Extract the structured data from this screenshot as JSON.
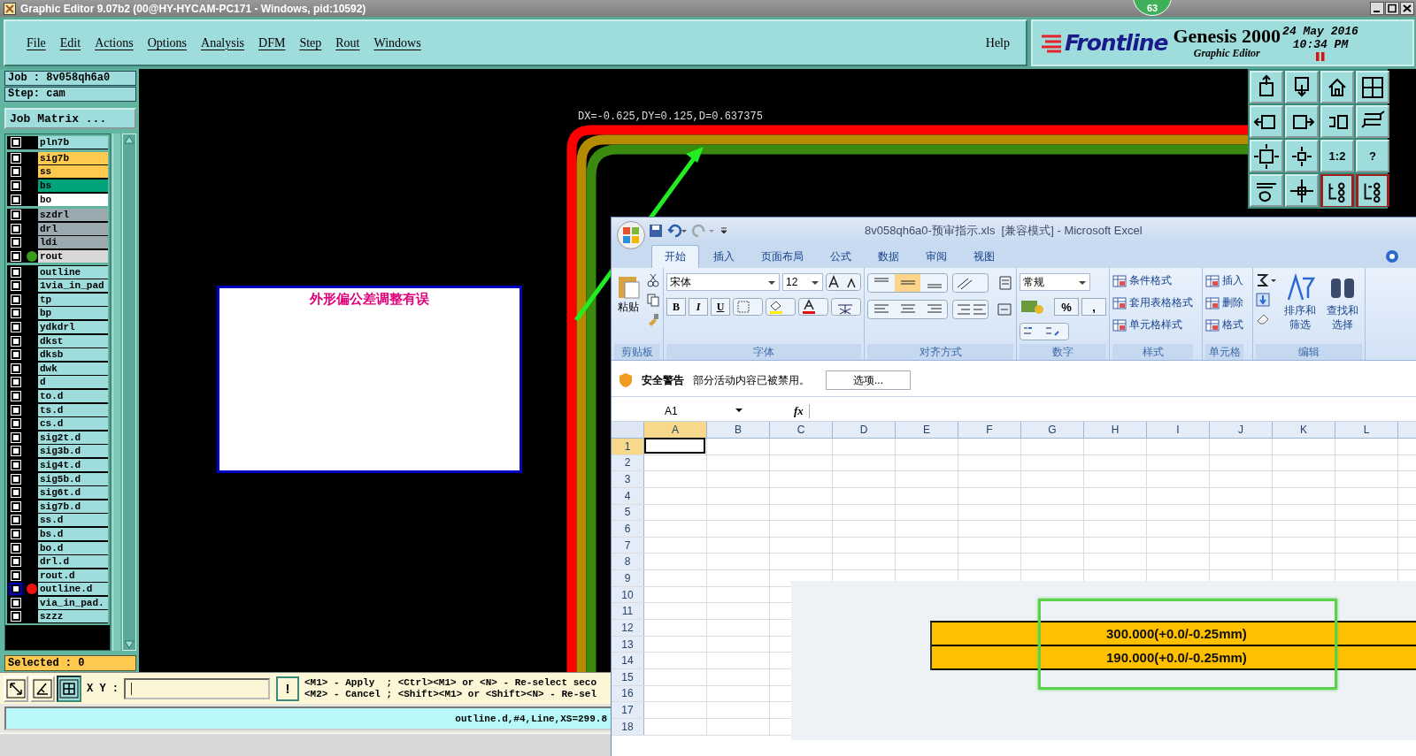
{
  "window": {
    "title": "Graphic Editor 9.07b2 (00@HY-HYCAM-PC171 - Windows, pid:10592)",
    "badge": "63"
  },
  "menu": [
    "File",
    "Edit",
    "Actions",
    "Options",
    "Analysis",
    "DFM",
    "Step",
    "Rout",
    "Windows"
  ],
  "help": "Help",
  "brand": {
    "logo": "Frontline",
    "product": "Genesis 2000",
    "subtitle": "Graphic Editor",
    "date": "24 May 2016",
    "time": "10:34 PM"
  },
  "job": "Job : 8v058qh6a0",
  "step": "Step: cam",
  "job_matrix": "Job Matrix ...",
  "layer_groups": [
    [
      {
        "name": "pln7b",
        "color": "#9fdcdc",
        "checked": false,
        "selected": false
      }
    ],
    [
      {
        "name": "sig7b",
        "color": "#ffc94f",
        "checked": false,
        "selected": false
      },
      {
        "name": "ss",
        "color": "#ffc94f",
        "checked": false,
        "selected": false
      },
      {
        "name": "bs",
        "color": "#00a37a",
        "checked": false,
        "selected": false
      },
      {
        "name": "bo",
        "color": "#ffffff",
        "checked": false,
        "selected": false
      }
    ],
    [
      {
        "name": "szdrl",
        "color": "#9aaab0",
        "checked": false,
        "selected": false
      },
      {
        "name": "drl",
        "color": "#9aaab0",
        "checked": false,
        "selected": false
      },
      {
        "name": "ldi",
        "color": "#9aaab0",
        "checked": false,
        "selected": false
      },
      {
        "name": "rout",
        "color": "#d8d8d8",
        "checked": false,
        "selected": false,
        "dot": {
          "color": "#3a9a1a"
        }
      }
    ],
    [
      {
        "name": "outline",
        "color": "#9fdcdc",
        "checked": false,
        "selected": false
      },
      {
        "name": "1via_in_pad",
        "color": "#9fdcdc",
        "checked": false,
        "selected": false
      },
      {
        "name": "tp",
        "color": "#9fdcdc",
        "checked": false,
        "selected": false
      },
      {
        "name": "bp",
        "color": "#9fdcdc",
        "checked": false,
        "selected": false
      },
      {
        "name": "ydkdrl",
        "color": "#9fdcdc",
        "checked": false,
        "selected": false
      },
      {
        "name": "dkst",
        "color": "#9fdcdc",
        "checked": false,
        "selected": false
      },
      {
        "name": "dksb",
        "color": "#9fdcdc",
        "checked": false,
        "selected": false
      },
      {
        "name": "dwk",
        "color": "#9fdcdc",
        "checked": false,
        "selected": false
      },
      {
        "name": "d",
        "color": "#9fdcdc",
        "checked": false,
        "selected": false
      },
      {
        "name": "to.d",
        "color": "#9fdcdc",
        "checked": false,
        "selected": false
      },
      {
        "name": "ts.d",
        "color": "#9fdcdc",
        "checked": false,
        "selected": false
      },
      {
        "name": "cs.d",
        "color": "#9fdcdc",
        "checked": false,
        "selected": false
      },
      {
        "name": "sig2t.d",
        "color": "#9fdcdc",
        "checked": false,
        "selected": false
      },
      {
        "name": "sig3b.d",
        "color": "#9fdcdc",
        "checked": false,
        "selected": false
      },
      {
        "name": "sig4t.d",
        "color": "#9fdcdc",
        "checked": false,
        "selected": false
      },
      {
        "name": "sig5b.d",
        "color": "#9fdcdc",
        "checked": false,
        "selected": false
      },
      {
        "name": "sig6t.d",
        "color": "#9fdcdc",
        "checked": false,
        "selected": false
      },
      {
        "name": "sig7b.d",
        "color": "#9fdcdc",
        "checked": false,
        "selected": false
      },
      {
        "name": "ss.d",
        "color": "#9fdcdc",
        "checked": false,
        "selected": false
      },
      {
        "name": "bs.d",
        "color": "#9fdcdc",
        "checked": false,
        "selected": false
      },
      {
        "name": "bo.d",
        "color": "#9fdcdc",
        "checked": false,
        "selected": false
      },
      {
        "name": "drl.d",
        "color": "#9fdcdc",
        "checked": false,
        "selected": false
      },
      {
        "name": "rout.d",
        "color": "#9fdcdc",
        "checked": false,
        "selected": false
      },
      {
        "name": "outline.d",
        "color": "#9fdcdc",
        "checked": false,
        "selected": true,
        "dot": {
          "color": "#ee1111"
        }
      },
      {
        "name": "via_in_pad.",
        "color": "#9fdcdc",
        "checked": false,
        "selected": false
      },
      {
        "name": "szzz",
        "color": "#9fdcdc",
        "checked": false,
        "selected": false
      }
    ]
  ],
  "selected_count": "Selected : 0",
  "tool_buttons": [
    {
      "selected": false
    },
    {
      "selected": false
    },
    {
      "selected": true
    }
  ],
  "xy_label": "X Y :",
  "exec_button": "!",
  "hints": [
    "<M1> - Apply  ; <Ctrl><M1> or <N> - Re-select seco",
    "<M2> - Cancel ; <Shift><M1> or <Shift><N> - Re-sel"
  ],
  "status": "outline.d,#4,Line,XS=299.8",
  "view_buttons": [
    {
      "selected": false
    },
    {
      "selected": false
    },
    {
      "selected": false
    },
    {
      "selected": false
    },
    {
      "selected": false
    },
    {
      "selected": false
    },
    {
      "selected": false
    },
    {
      "selected": false
    },
    {
      "selected": false
    },
    {
      "selected": false
    },
    {
      "label": "1:2",
      "selected": false
    },
    {
      "label": "?",
      "selected": false
    },
    {
      "selected": false
    },
    {
      "selected": false
    },
    {
      "selected": true
    },
    {
      "selected": true
    }
  ],
  "canvas": {
    "measure": "DX=-0.625,DY=0.125,D=0.637375",
    "note": "外形偏公差调整有误"
  },
  "excel": {
    "title": "8v058qh6a0-预审指示.xls  [兼容模式] - Microsoft Excel",
    "tabs": [
      {
        "label": "开始",
        "selected": true
      },
      {
        "label": "插入",
        "selected": false
      },
      {
        "label": "页面布局",
        "selected": false
      },
      {
        "label": "公式",
        "selected": false
      },
      {
        "label": "数据",
        "selected": false
      },
      {
        "label": "审阅",
        "selected": false
      },
      {
        "label": "视图",
        "selected": false
      }
    ],
    "groups": [
      {
        "kind": "clipboard",
        "label": "剪贴板",
        "paste": "粘贴"
      },
      {
        "kind": "font",
        "label": "字体",
        "font": "宋体",
        "size": "12",
        "styles": [
          "B",
          "I",
          "U"
        ]
      },
      {
        "kind": "align",
        "label": "对齐方式"
      },
      {
        "kind": "number",
        "label": "数字",
        "format": "常规",
        "percent": "%",
        "comma": ","
      },
      {
        "kind": "list",
        "label": "样式",
        "items": [
          "条件格式",
          "套用表格格式",
          "单元格样式"
        ]
      },
      {
        "kind": "list",
        "label": "单元格",
        "items": [
          "插入",
          "删除",
          "格式"
        ]
      },
      {
        "kind": "edit",
        "label": "编辑",
        "items": [
          "排序和筛选",
          "查找和选择"
        ]
      }
    ],
    "warning": {
      "title": "安全警告",
      "message": "部分活动内容已被禁用。",
      "button": "选项..."
    },
    "name_box": "A1",
    "fx": "fx",
    "columns": [
      "A",
      "B",
      "C",
      "D",
      "E",
      "F",
      "G",
      "H",
      "I",
      "J",
      "K",
      "L"
    ],
    "rows": [
      "1",
      "2",
      "3",
      "4",
      "5",
      "6",
      "7",
      "8",
      "9",
      "10",
      "11",
      "12",
      "13",
      "14",
      "15",
      "16",
      "17",
      "18"
    ],
    "pasted_rows": [
      "300.000(+0.0/-0.25mm)",
      "190.000(+0.0/-0.25mm)"
    ]
  }
}
